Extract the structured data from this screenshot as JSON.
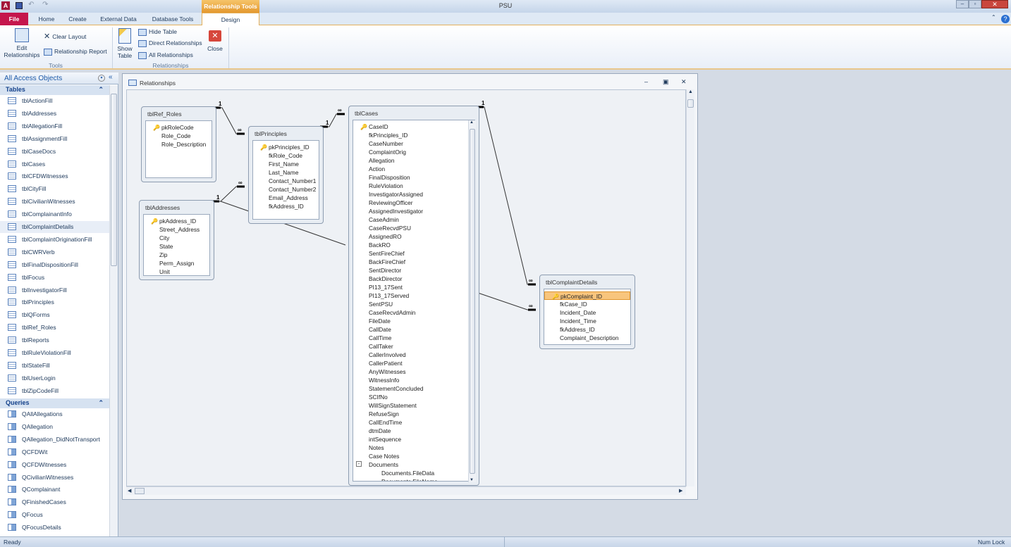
{
  "app": {
    "title": "PSU",
    "context_tab_group": "Relationship Tools"
  },
  "tabs": [
    "File",
    "Home",
    "Create",
    "External Data",
    "Database Tools",
    "Design"
  ],
  "ribbon": {
    "tools": {
      "label": "Tools",
      "edit_relationships": "Edit Relationships",
      "clear_layout": "Clear Layout",
      "relationship_report": "Relationship Report"
    },
    "relationships": {
      "label": "Relationships",
      "show_table": "Show Table",
      "hide_table": "Hide Table",
      "direct_relationships": "Direct Relationships",
      "all_relationships": "All Relationships",
      "close": "Close"
    }
  },
  "nav": {
    "header": "All Access Objects",
    "tables_label": "Tables",
    "queries_label": "Queries",
    "tables": [
      "tblActionFill",
      "tblAddresses",
      "tblAllegationFill",
      "tblAssignmentFill",
      "tblCaseDocs",
      "tblCases",
      "tblCFDWitnesses",
      "tblCityFill",
      "tblCivilianWitnesses",
      "tblComplainantInfo",
      "tblComplaintDetails",
      "tblComplaintOriginationFill",
      "tblCWRVerb",
      "tblFinalDispositionFill",
      "tblFocus",
      "tblInvestigatorFill",
      "tblPrinciples",
      "tblQForms",
      "tblRef_Roles",
      "tblReports",
      "tblRuleViolationFill",
      "tblStateFill",
      "tblUserLogin",
      "tblZipCodeFill"
    ],
    "selected_table": "tblComplaintDetails",
    "queries": [
      "QAllAllegations",
      "QAllegation",
      "QAllegation_DidNotTransport",
      "QCFDWit",
      "QCFDWitnesses",
      "QCivilianWitnesses",
      "QComplainant",
      "QFinishedCases",
      "QFocus",
      "QFocusDetails"
    ]
  },
  "relwindow": {
    "title": "Relationships",
    "tables": [
      {
        "name": "tblRef_Roles",
        "fields": [
          "pkRoleCode",
          "Role_Code",
          "Role_Description"
        ]
      },
      {
        "name": "tblPrinciples",
        "fields": [
          "pkPrinciples_ID",
          "fkRole_Code",
          "First_Name",
          "Last_Name",
          "Contact_Number1",
          "Contact_Number2",
          "Email_Address",
          "fkAddress_ID"
        ]
      },
      {
        "name": "tblAddresses",
        "fields": [
          "pkAddress_ID",
          "Street_Address",
          "City",
          "State",
          "Zip",
          "Perm_Assign",
          "Unit"
        ]
      },
      {
        "name": "tblCases",
        "fields": [
          "CaseID",
          "fkPrinciples_ID",
          "CaseNumber",
          "ComplaintOrig",
          "Allegation",
          "Action",
          "FinalDisposition",
          "RuleViolation",
          "InvestigatorAssigned",
          "ReviewingOfficer",
          "AssignedInvestigator",
          "CaseAdmin",
          "CaseRecvdPSU",
          "AssignedRO",
          "BackRO",
          "SentFireChief",
          "BackFireChief",
          "SentDirector",
          "BackDirector",
          "PI13_17Sent",
          "PI13_17Served",
          "SentPSU",
          "CaseRecvdAdmin",
          "FileDate",
          "CallDate",
          "CallTime",
          "CallTaker",
          "CallerInvolved",
          "CallerPatient",
          "AnyWitnesses",
          "WitnessInfo",
          "StatementConcluded",
          "SCIfNo",
          "WillSignStatement",
          "RefuseSign",
          "CallEndTime",
          "dtmDate",
          "intSequence",
          "Notes",
          "Case Notes",
          "Documents",
          "Documents.FileData",
          "Documents.FileName"
        ]
      },
      {
        "name": "tblComplaintDetails",
        "fields": [
          "pkComplaint_ID",
          "fkCase_ID",
          "Incident_Date",
          "Incident_Time",
          "fkAddress_ID",
          "Complaint_Description"
        ]
      }
    ],
    "one_label": "1",
    "many_label": "∞"
  },
  "status": {
    "left": "Ready",
    "right": "Num Lock"
  },
  "colors": {
    "file_tab": "#c5164c",
    "context": "#e4982e",
    "highlight": "#f8c57d"
  }
}
